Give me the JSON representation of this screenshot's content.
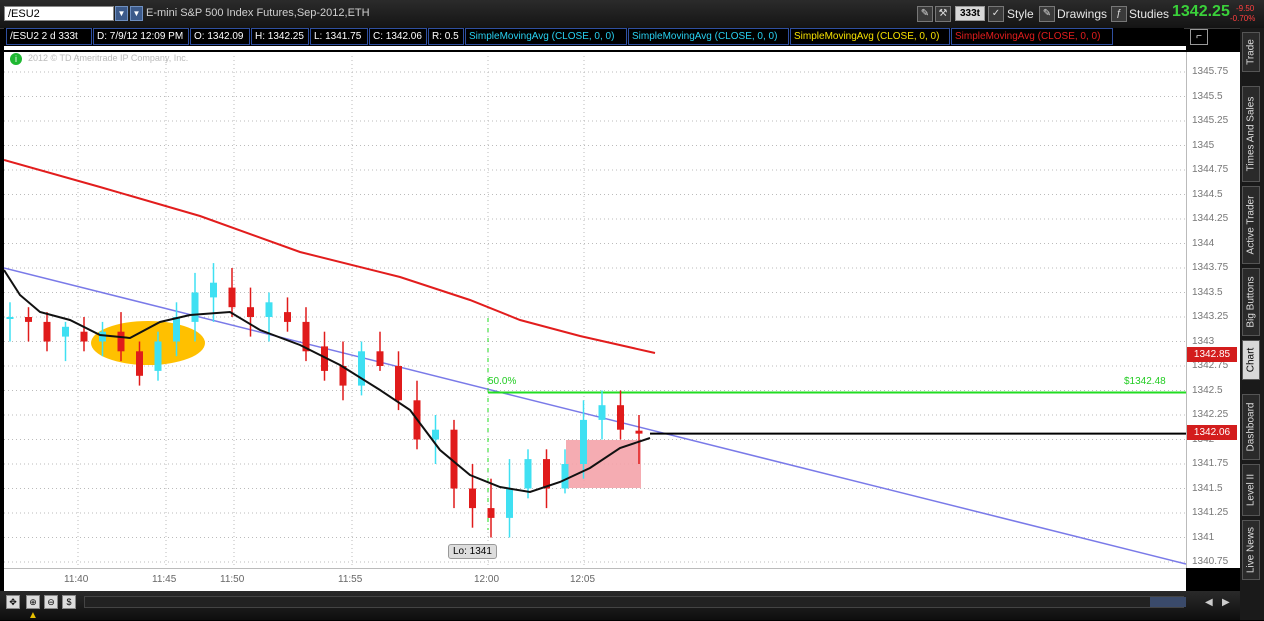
{
  "toolbar": {
    "symbol": "/ESU2",
    "description": "E-mini S&P 500 Index Futures,Sep-2012,ETH",
    "aggregation": "333t",
    "style_label": "Style",
    "drawings_label": "Drawings",
    "studies_label": "Studies",
    "last_price": "1342.25",
    "change_abs": "-9.50",
    "change_pct": "-0.70%"
  },
  "header": {
    "symbol_period": "/ESU2 2 d 333t",
    "date": "D: 7/9/12 12:09 PM",
    "open": "O: 1342.09",
    "high": "H: 1342.25",
    "low": "L: 1341.75",
    "close": "C: 1342.06",
    "range": "R: 0.5",
    "studies": [
      {
        "label": "SimpleMovingAvg (CLOSE, 0, 0)",
        "color": "#28d0f0"
      },
      {
        "label": "SimpleMovingAvg (CLOSE, 0, 0)",
        "color": "#28d0f0"
      },
      {
        "label": "SimpleMovingAvg (CLOSE, 0, 0)",
        "color": "#f5e000"
      },
      {
        "label": "SimpleMovingAvg (CLOSE, 0, 0)",
        "color": "#e21d1d"
      }
    ]
  },
  "copyright": "2012 © TD Ameritrade IP Company, Inc.",
  "annotations": {
    "fib_label": "50.0%",
    "level_label": "$1342.48",
    "low_label": "Lo: 1341"
  },
  "price_axis": {
    "ticks": [
      "1345.75",
      "1345.5",
      "1345.25",
      "1345",
      "1344.75",
      "1344.5",
      "1344.25",
      "1344",
      "1343.75",
      "1343.5",
      "1343.25",
      "1343",
      "1342.75",
      "1342.5",
      "1342.25",
      "1342",
      "1341.75",
      "1341.5",
      "1341.25",
      "1341",
      "1340.75"
    ],
    "label_sma": "1342.85",
    "label_last": "1342.06"
  },
  "time_axis": {
    "ticks": [
      "11:40",
      "11:45",
      "11:50",
      "11:55",
      "12:00",
      "12:05"
    ]
  },
  "side_tabs": [
    "Trade",
    "Times And Sales",
    "Active Trader",
    "Big Buttons",
    "Chart",
    "Dashboard",
    "Level II",
    "Live News"
  ],
  "colors": {
    "up_candle": "#3fe0f2",
    "down_candle": "#e01b1b",
    "sma_fast": "#111111",
    "sma_slow": "#e21d1d",
    "trendline": "#7a7ae8",
    "level_line": "#22dd22",
    "highlight_ellipse": "#ffc000",
    "highlight_rect": "#f4a3aa"
  },
  "chart_data": {
    "type": "candlestick",
    "candles": [
      {
        "t": "11:35",
        "o": 1343.25,
        "h": 1343.4,
        "l": 1343.0,
        "c": 1343.25
      },
      {
        "t": "11:36",
        "o": 1343.25,
        "h": 1343.35,
        "l": 1343.0,
        "c": 1343.2
      },
      {
        "t": "11:37",
        "o": 1343.2,
        "h": 1343.3,
        "l": 1342.9,
        "c": 1343.0
      },
      {
        "t": "11:38",
        "o": 1343.05,
        "h": 1343.2,
        "l": 1342.8,
        "c": 1343.15
      },
      {
        "t": "11:39",
        "o": 1343.1,
        "h": 1343.25,
        "l": 1342.9,
        "c": 1343.0
      },
      {
        "t": "11:40",
        "o": 1343.0,
        "h": 1343.2,
        "l": 1342.85,
        "c": 1343.1
      },
      {
        "t": "11:41",
        "o": 1343.1,
        "h": 1343.3,
        "l": 1342.8,
        "c": 1342.9
      },
      {
        "t": "11:42",
        "o": 1342.9,
        "h": 1343.0,
        "l": 1342.55,
        "c": 1342.65
      },
      {
        "t": "11:43",
        "o": 1342.7,
        "h": 1343.1,
        "l": 1342.6,
        "c": 1343.0
      },
      {
        "t": "11:44",
        "o": 1343.0,
        "h": 1343.4,
        "l": 1342.85,
        "c": 1343.25
      },
      {
        "t": "11:45",
        "o": 1343.2,
        "h": 1343.7,
        "l": 1343.0,
        "c": 1343.5
      },
      {
        "t": "11:46",
        "o": 1343.45,
        "h": 1343.8,
        "l": 1343.2,
        "c": 1343.6
      },
      {
        "t": "11:47",
        "o": 1343.55,
        "h": 1343.75,
        "l": 1343.25,
        "c": 1343.35
      },
      {
        "t": "11:48",
        "o": 1343.35,
        "h": 1343.55,
        "l": 1343.05,
        "c": 1343.25
      },
      {
        "t": "11:49",
        "o": 1343.25,
        "h": 1343.5,
        "l": 1343.0,
        "c": 1343.4
      },
      {
        "t": "11:50",
        "o": 1343.3,
        "h": 1343.45,
        "l": 1343.1,
        "c": 1343.2
      },
      {
        "t": "11:51",
        "o": 1343.2,
        "h": 1343.35,
        "l": 1342.8,
        "c": 1342.9
      },
      {
        "t": "11:52",
        "o": 1342.95,
        "h": 1343.1,
        "l": 1342.6,
        "c": 1342.7
      },
      {
        "t": "11:53",
        "o": 1342.75,
        "h": 1343.0,
        "l": 1342.4,
        "c": 1342.55
      },
      {
        "t": "11:54",
        "o": 1342.55,
        "h": 1343.0,
        "l": 1342.45,
        "c": 1342.9
      },
      {
        "t": "11:55",
        "o": 1342.9,
        "h": 1343.1,
        "l": 1342.7,
        "c": 1342.75
      },
      {
        "t": "11:56",
        "o": 1342.75,
        "h": 1342.9,
        "l": 1342.3,
        "c": 1342.4
      },
      {
        "t": "11:57",
        "o": 1342.4,
        "h": 1342.6,
        "l": 1341.9,
        "c": 1342.0
      },
      {
        "t": "11:58",
        "o": 1342.0,
        "h": 1342.25,
        "l": 1341.75,
        "c": 1342.1
      },
      {
        "t": "11:59",
        "o": 1342.1,
        "h": 1342.2,
        "l": 1341.3,
        "c": 1341.5
      },
      {
        "t": "12:00",
        "o": 1341.5,
        "h": 1341.75,
        "l": 1341.1,
        "c": 1341.3
      },
      {
        "t": "12:01",
        "o": 1341.3,
        "h": 1341.6,
        "l": 1341.0,
        "c": 1341.2
      },
      {
        "t": "12:02",
        "o": 1341.2,
        "h": 1341.8,
        "l": 1341.0,
        "c": 1341.5
      },
      {
        "t": "12:03",
        "o": 1341.5,
        "h": 1341.9,
        "l": 1341.4,
        "c": 1341.8
      },
      {
        "t": "12:04",
        "o": 1341.8,
        "h": 1341.9,
        "l": 1341.3,
        "c": 1341.5
      },
      {
        "t": "12:05",
        "o": 1341.5,
        "h": 1341.9,
        "l": 1341.45,
        "c": 1341.75
      },
      {
        "t": "12:06",
        "o": 1341.75,
        "h": 1342.4,
        "l": 1341.6,
        "c": 1342.2
      },
      {
        "t": "12:07",
        "o": 1342.2,
        "h": 1342.5,
        "l": 1342.0,
        "c": 1342.35
      },
      {
        "t": "12:08",
        "o": 1342.35,
        "h": 1342.5,
        "l": 1342.0,
        "c": 1342.1
      },
      {
        "t": "12:09",
        "o": 1342.09,
        "h": 1342.25,
        "l": 1341.75,
        "c": 1342.06
      }
    ],
    "ylim": [
      1340.75,
      1345.75
    ],
    "sma_slow_end": 1342.85,
    "fib_level": 1342.48,
    "last": 1342.06,
    "low": 1341
  }
}
